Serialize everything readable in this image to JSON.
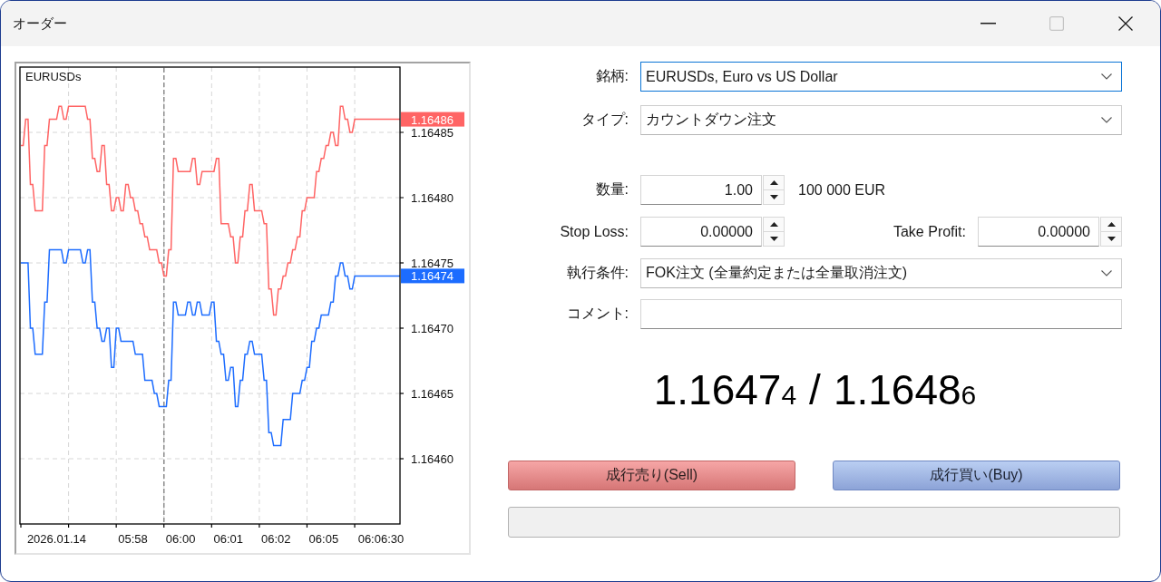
{
  "window": {
    "title": "オーダー",
    "controls": [
      {
        "kind": "minimize",
        "disabled": false
      },
      {
        "kind": "maximize",
        "disabled": true
      },
      {
        "kind": "close",
        "disabled": false
      }
    ]
  },
  "chart": {
    "chart_data": {
      "type": "line",
      "title": "EURUSDs",
      "grid": true,
      "ylim": [
        1.16455,
        1.1649
      ],
      "yticks": [
        {
          "value": 1.1646,
          "label": "1.16460"
        },
        {
          "value": 1.16465,
          "label": "1.16465"
        },
        {
          "value": 1.1647,
          "label": "1.16470"
        },
        {
          "value": 1.16475,
          "label": "1.16475"
        },
        {
          "value": 1.1648,
          "label": "1.16480"
        },
        {
          "value": 1.16485,
          "label": "1.16485"
        }
      ],
      "categories": [
        null,
        null,
        null,
        null,
        null,
        null,
        null,
        null,
        null,
        null,
        null,
        null,
        null,
        null,
        null,
        "2026.01.14",
        null,
        null,
        null,
        null,
        null,
        null,
        null,
        null,
        null,
        null,
        null,
        null,
        null,
        null,
        null,
        null,
        null,
        null,
        null,
        null,
        null,
        null,
        null,
        null,
        null,
        null,
        null,
        null,
        null,
        null,
        null,
        "05:58",
        null,
        null,
        null,
        null,
        null,
        null,
        null,
        null,
        null,
        null,
        null,
        null,
        null,
        null,
        null,
        null,
        null,
        null,
        null,
        "06:00",
        null,
        null,
        null,
        null,
        null,
        null,
        null,
        null,
        null,
        null,
        null,
        null,
        null,
        null,
        null,
        null,
        null,
        null,
        null,
        "06:01",
        null,
        null,
        null,
        null,
        null,
        null,
        null,
        null,
        null,
        null,
        null,
        null,
        null,
        null,
        null,
        null,
        null,
        null,
        null,
        "06:02",
        null,
        null,
        null,
        null,
        null,
        null,
        null,
        null,
        null,
        null,
        null,
        null,
        null,
        null,
        null,
        null,
        null,
        null,
        null,
        "06:05",
        null,
        null,
        null,
        null,
        null,
        null,
        null,
        null,
        null,
        null,
        null,
        null,
        null,
        null,
        null,
        null,
        null,
        null,
        null,
        null,
        null,
        null,
        null,
        "06:06:30",
        null,
        null,
        null,
        null,
        null,
        null,
        null,
        null
      ],
      "series": [
        {
          "color": "#ff6464",
          "values": [
            1.16484,
            1.16484,
            1.16486,
            1.16486,
            1.16481,
            1.16481,
            1.16479,
            1.16479,
            1.16479,
            1.16479,
            1.16484,
            1.16484,
            1.16486,
            1.16486,
            1.16486,
            1.16486,
            1.16487,
            1.16487,
            1.16486,
            1.16486,
            1.16487,
            1.16487,
            1.16487,
            1.16487,
            1.16487,
            1.16487,
            1.16487,
            1.16487,
            1.16486,
            1.16486,
            1.16483,
            1.16483,
            1.16482,
            1.16482,
            1.16484,
            1.16484,
            1.16481,
            1.16481,
            1.16479,
            1.16479,
            1.1648,
            1.1648,
            1.16479,
            1.16479,
            1.16481,
            1.16481,
            1.1648,
            1.1648,
            1.16479,
            1.16479,
            1.16478,
            1.16478,
            1.16477,
            1.16477,
            1.16476,
            1.16476,
            1.16476,
            1.16476,
            1.16475,
            1.16475,
            1.16474,
            1.16474,
            1.16476,
            1.16476,
            1.16483,
            1.16483,
            1.16482,
            1.16482,
            1.16482,
            1.16482,
            1.16482,
            1.16482,
            1.16483,
            1.16483,
            1.16481,
            1.16481,
            1.16482,
            1.16482,
            1.16482,
            1.16482,
            1.16482,
            1.16482,
            1.16483,
            1.16483,
            1.16478,
            1.16478,
            1.16478,
            1.16478,
            1.16477,
            1.16477,
            1.16475,
            1.16475,
            1.16477,
            1.16477,
            1.16479,
            1.16479,
            1.16481,
            1.16481,
            1.16479,
            1.16479,
            1.16479,
            1.16479,
            1.16478,
            1.16478,
            1.16473,
            1.16473,
            1.16471,
            1.16471,
            1.16473,
            1.16473,
            1.16474,
            1.16474,
            1.16475,
            1.16475,
            1.16476,
            1.16476,
            1.16477,
            1.16477,
            1.16479,
            1.16479,
            1.1648,
            1.1648,
            1.1648,
            1.1648,
            1.16482,
            1.16482,
            1.16483,
            1.16483,
            1.16484,
            1.16484,
            1.16485,
            1.16485,
            1.16484,
            1.16484,
            1.16487,
            1.16487,
            1.16486,
            1.16486,
            1.16485,
            1.16485,
            1.16486,
            1.16486,
            1.16486,
            1.16486,
            1.16486,
            1.16486,
            1.16486,
            1.16486,
            1.16486,
            1.16486,
            1.16486,
            1.16486,
            1.16486,
            1.16486,
            1.16486,
            1.16486,
            1.16486,
            1.16486,
            1.16486,
            1.16486
          ]
        },
        {
          "color": "#1c6cff",
          "values": [
            1.16475,
            1.16475,
            1.16475,
            1.16475,
            1.1647,
            1.1647,
            1.16468,
            1.16468,
            1.16468,
            1.16468,
            1.16472,
            1.16472,
            1.16476,
            1.16476,
            1.16476,
            1.16476,
            1.16476,
            1.16476,
            1.16475,
            1.16475,
            1.16476,
            1.16476,
            1.16476,
            1.16476,
            1.16476,
            1.16476,
            1.16475,
            1.16475,
            1.16476,
            1.16476,
            1.16472,
            1.16472,
            1.1647,
            1.1647,
            1.16469,
            1.16469,
            1.1647,
            1.1647,
            1.16467,
            1.16467,
            1.1647,
            1.1647,
            1.16469,
            1.16469,
            1.16469,
            1.16469,
            1.16469,
            1.16469,
            1.16468,
            1.16468,
            1.16468,
            1.16468,
            1.16466,
            1.16466,
            1.16466,
            1.16466,
            1.16465,
            1.16465,
            1.16464,
            1.16464,
            1.16464,
            1.16464,
            1.16466,
            1.16466,
            1.16472,
            1.16472,
            1.16471,
            1.16471,
            1.16471,
            1.16471,
            1.16472,
            1.16472,
            1.16471,
            1.16471,
            1.16472,
            1.16472,
            1.16471,
            1.16471,
            1.16471,
            1.16471,
            1.16472,
            1.16472,
            1.16469,
            1.16469,
            1.16468,
            1.16468,
            1.16466,
            1.16466,
            1.16467,
            1.16467,
            1.16464,
            1.16464,
            1.16466,
            1.16466,
            1.16468,
            1.16468,
            1.16469,
            1.16469,
            1.16468,
            1.16468,
            1.16468,
            1.16468,
            1.16466,
            1.16466,
            1.16462,
            1.16462,
            1.16461,
            1.16461,
            1.16461,
            1.16461,
            1.16463,
            1.16463,
            1.16463,
            1.16463,
            1.16465,
            1.16465,
            1.16465,
            1.16465,
            1.16466,
            1.16466,
            1.16467,
            1.16467,
            1.16469,
            1.16469,
            1.1647,
            1.1647,
            1.16471,
            1.16471,
            1.16471,
            1.16471,
            1.16472,
            1.16472,
            1.16474,
            1.16474,
            1.16475,
            1.16475,
            1.16474,
            1.16474,
            1.16473,
            1.16473,
            1.16474,
            1.16474,
            1.16474,
            1.16474,
            1.16474,
            1.16474,
            1.16474,
            1.16474,
            1.16474,
            1.16474,
            1.16474,
            1.16474,
            1.16474,
            1.16474,
            1.16474,
            1.16474,
            1.16474,
            1.16474,
            1.16474,
            1.16474
          ]
        }
      ],
      "annotations": [
        "1.16486",
        "1.16474"
      ]
    }
  },
  "symbol": {
    "label": "銘柄:",
    "value": "EURUSDs, Euro vs US Dollar",
    "focused": true
  },
  "order_type": {
    "label": "タイプ:",
    "value": "カウントダウン注文",
    "focused": false
  },
  "volume": {
    "label": "数量:",
    "value": "1.00",
    "unit": "100 000 EUR"
  },
  "stop_loss": {
    "label": "Stop Loss:",
    "value": "0.00000"
  },
  "take_profit": {
    "label": "Take Profit:",
    "value": "0.00000"
  },
  "fill_policy": {
    "label": "執行条件:",
    "value": "FOK注文 (全量約定または全量取消注文)",
    "focused": false
  },
  "comment": {
    "label": "コメント:"
  },
  "quote": {
    "bid": "1.1647",
    "bid_pip": "4",
    "separator": "/",
    "ask": "1.1648",
    "ask_pip": "6"
  },
  "buttons": [
    {
      "kind": "sell",
      "label": "成行売り(Sell)"
    },
    {
      "kind": "buy",
      "label": "成行買い(Buy)"
    }
  ]
}
